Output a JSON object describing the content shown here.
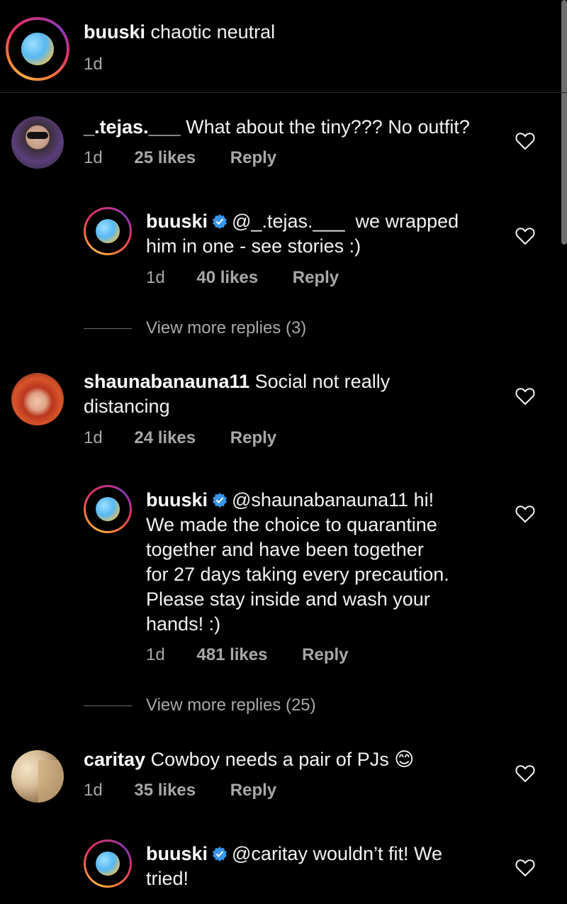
{
  "caption": {
    "username": "buuski",
    "text": "chaotic neutral",
    "time": "1d"
  },
  "comments": [
    {
      "username": "_.tejas.___",
      "text": "What about the tiny??? No outfit?",
      "time": "1d",
      "likes": "25 likes",
      "reply": "Reply",
      "replies": [
        {
          "username": "buuski",
          "mention": "@_.tejas.___",
          "text_line1": "we wrapped",
          "text_line2": "him in one - see stories :)",
          "time": "1d",
          "likes": "40 likes",
          "reply": "Reply"
        }
      ],
      "view_more": "View more replies (3)"
    },
    {
      "username": "shaunabanauna11",
      "text_line1": "Social not really",
      "text_line2": "distancing",
      "time": "1d",
      "likes": "24 likes",
      "reply": "Reply",
      "replies": [
        {
          "username": "buuski",
          "mention": "@shaunabanauna11 hi!",
          "lines": [
            "We made the choice to quarantine",
            "together and have been together",
            "for 27 days taking every precaution.",
            "Please stay inside and wash your",
            "hands! :)"
          ],
          "time": "1d",
          "likes": "481 likes",
          "reply": "Reply"
        }
      ],
      "view_more": "View more replies (25)"
    },
    {
      "username": "caritay",
      "text": "Cowboy needs a pair of PJs",
      "emoji": "😊",
      "time": "1d",
      "likes": "35 likes",
      "reply": "Reply",
      "replies": [
        {
          "username": "buuski",
          "mention": "@caritay wouldn’t fit! We",
          "text_line2": "tried!"
        }
      ]
    }
  ],
  "colors": {
    "background": "#000000",
    "text": "#f2f2f2",
    "secondary": "#a8a8a8",
    "verified": "#3897f0"
  },
  "icons": {
    "like": "heart-outline-icon",
    "verified": "verified-badge-icon"
  }
}
